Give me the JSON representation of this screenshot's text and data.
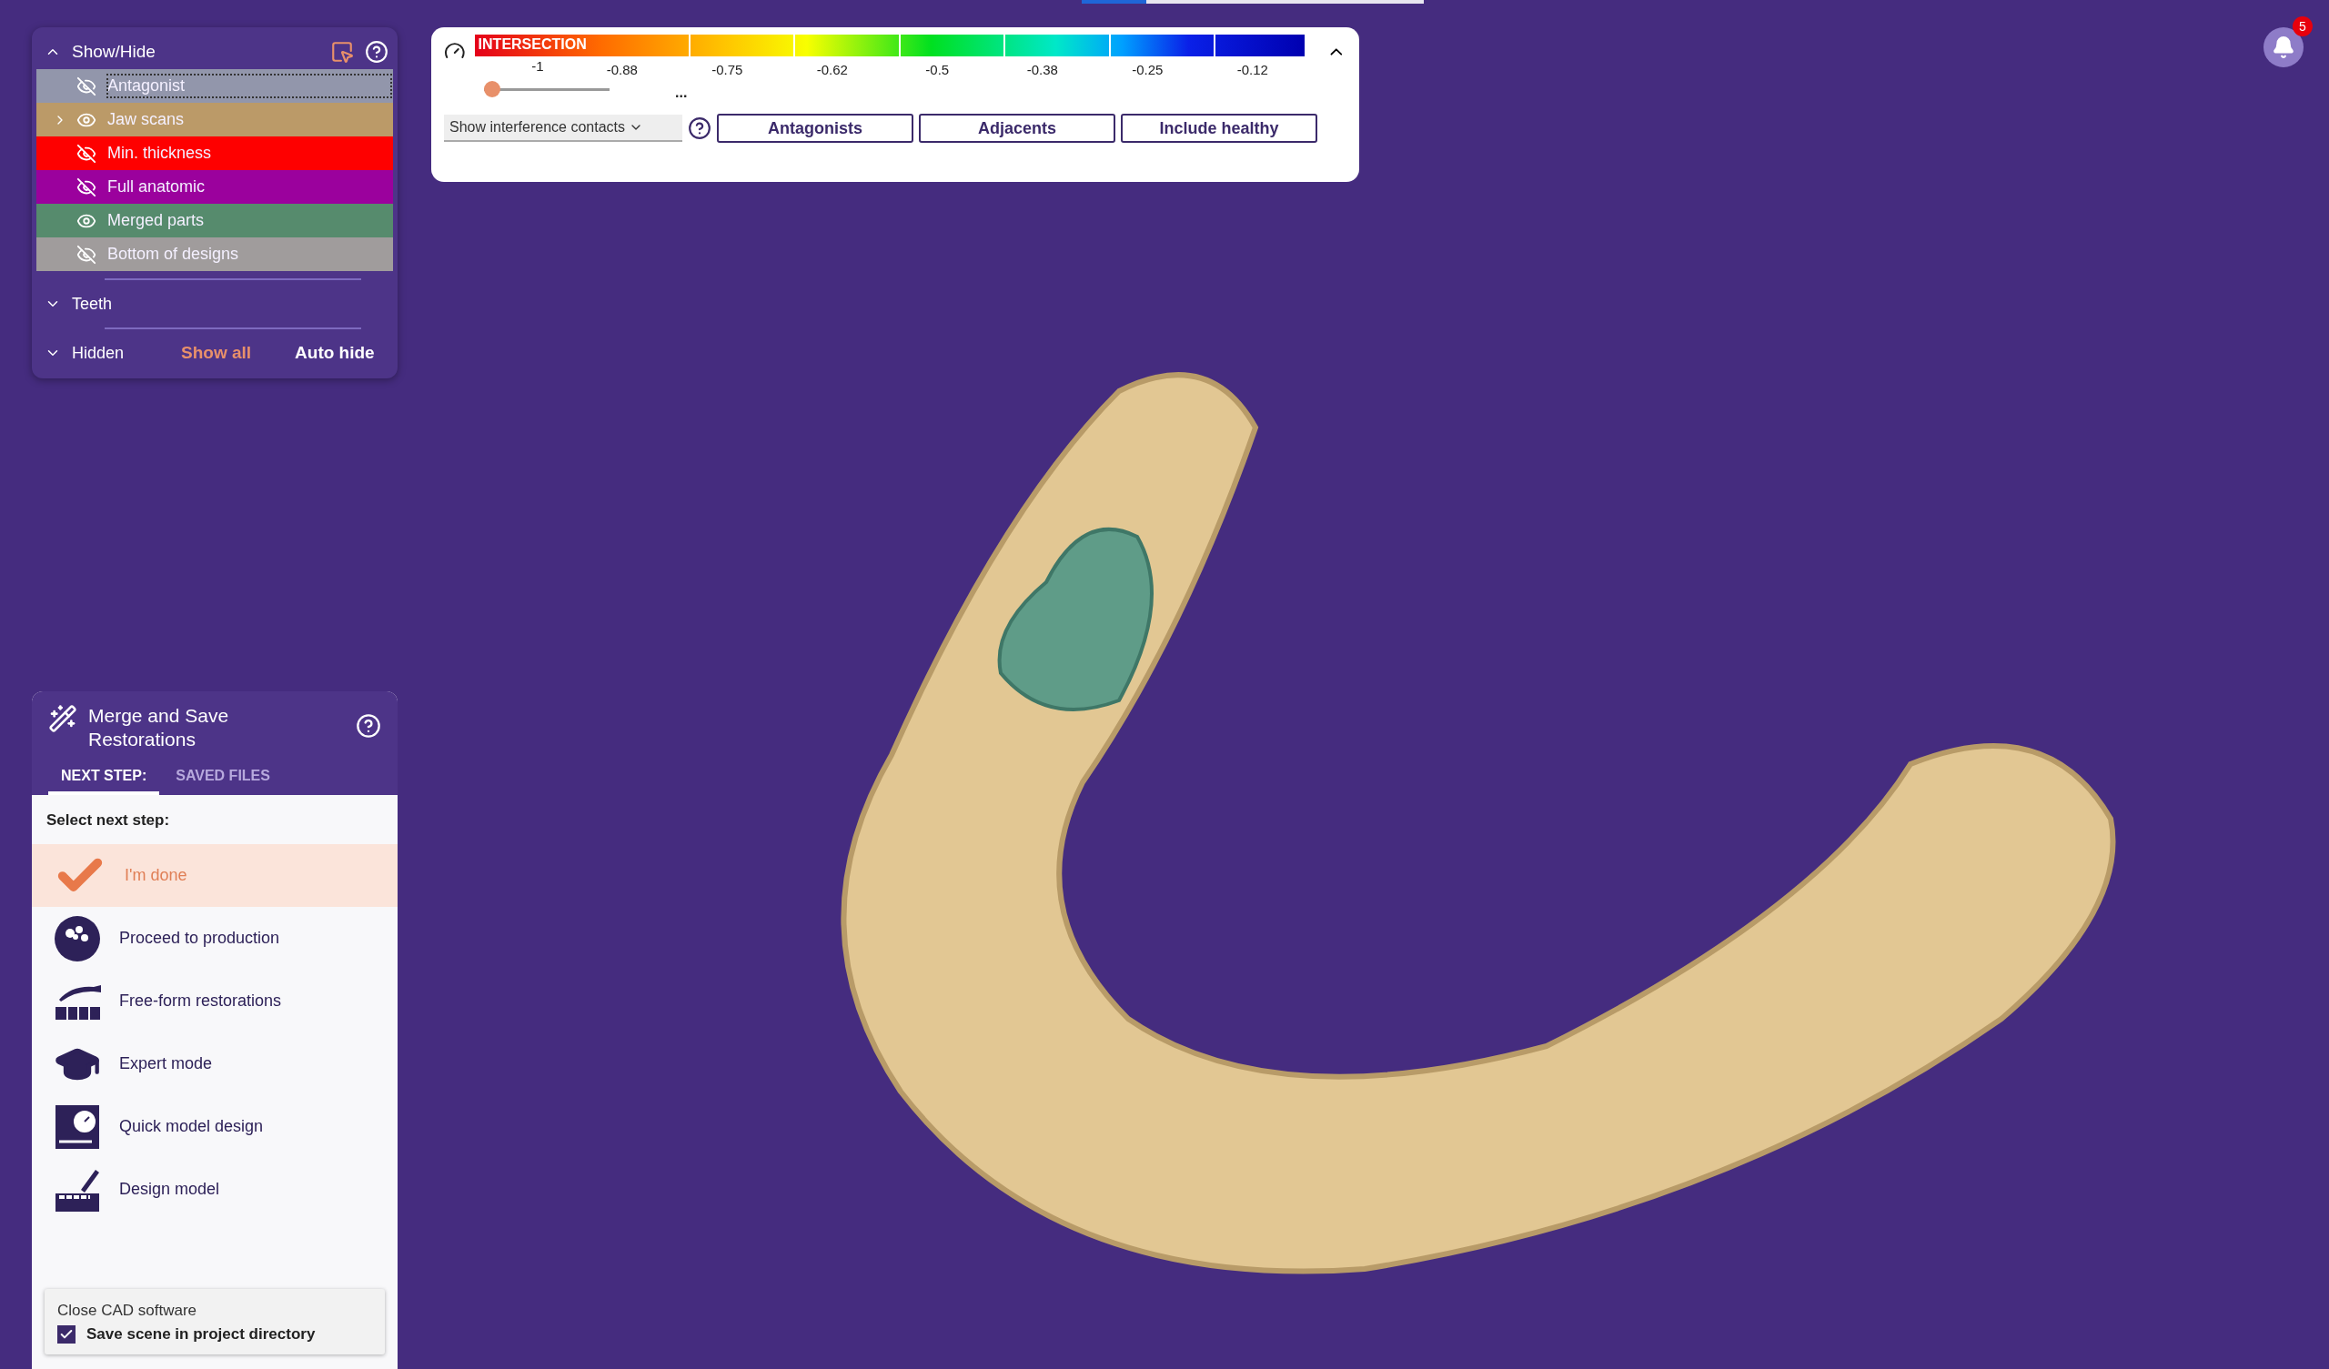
{
  "top_progress": {
    "level": 0.19
  },
  "show_hide": {
    "title": "Show/Hide",
    "expanded": true,
    "items": [
      {
        "label": "Antagonist",
        "visible": false,
        "has_children": false,
        "selected": true,
        "color": "#9296ab"
      },
      {
        "label": "Jaw scans",
        "visible": true,
        "has_children": true,
        "selected": false,
        "color": "#bb9a68"
      },
      {
        "label": "Min. thickness",
        "visible": false,
        "has_children": false,
        "selected": false,
        "color": "#fe0000"
      },
      {
        "label": "Full anatomic",
        "visible": false,
        "has_children": false,
        "selected": false,
        "color": "#9b019d"
      },
      {
        "label": "Merged parts",
        "visible": true,
        "has_children": false,
        "selected": false,
        "color": "#568b6d"
      },
      {
        "label": "Bottom of designs",
        "visible": false,
        "has_children": false,
        "selected": false,
        "color": "#a09c9c"
      }
    ],
    "sections": [
      {
        "label": "Teeth",
        "expanded": false
      },
      {
        "label": "Hidden",
        "expanded": false
      }
    ],
    "show_all": "Show all",
    "auto_hide": "Auto hide"
  },
  "intersection": {
    "title": "INTERSECTION",
    "scale_labels": [
      "-1",
      "-0.88",
      "-0.75",
      "-0.62",
      "-0.5",
      "-0.38",
      "-0.25",
      "-0.12"
    ],
    "slider": {
      "level": 0
    },
    "more": "...",
    "expanded": true,
    "dropdown": {
      "value": "Show interference contacts"
    },
    "buttons": [
      "Antagonists",
      "Adjacents",
      "Include healthy"
    ]
  },
  "merge_panel": {
    "title": "Merge and Save Restorations",
    "tabs": [
      {
        "label": "NEXT STEP:",
        "selected": true
      },
      {
        "label": "SAVED FILES",
        "selected": false
      }
    ],
    "prompt": "Select next step:",
    "steps": [
      {
        "kind": "done",
        "label": "I'm done",
        "selected": true
      },
      {
        "kind": "production",
        "label": "Proceed to production",
        "selected": false
      },
      {
        "kind": "freeform",
        "label": "Free-form restorations",
        "selected": false
      },
      {
        "kind": "expert",
        "label": "Expert mode",
        "selected": false
      },
      {
        "kind": "quick",
        "label": "Quick model design",
        "selected": false
      },
      {
        "kind": "design",
        "label": "Design model",
        "selected": false
      }
    ],
    "footer": {
      "title": "Close CAD software",
      "checkbox": {
        "label": "Save scene in project directory",
        "checked": true
      }
    }
  },
  "notifications": {
    "count": "5"
  }
}
